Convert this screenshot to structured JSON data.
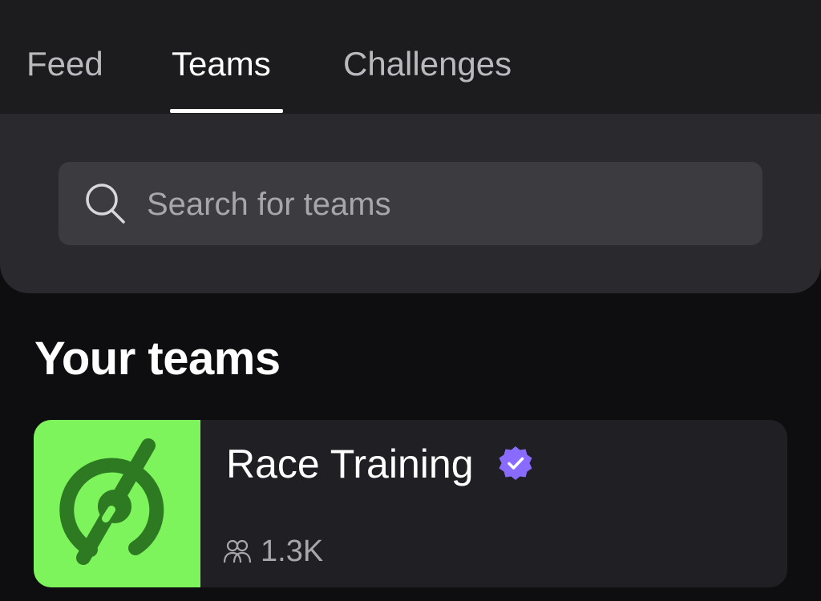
{
  "tabs": [
    {
      "label": "Feed",
      "active": false
    },
    {
      "label": "Teams",
      "active": true
    },
    {
      "label": "Challenges",
      "active": false
    }
  ],
  "search": {
    "placeholder": "Search for teams",
    "value": "",
    "icon": "search-icon"
  },
  "your_teams": {
    "title": "Your teams",
    "teams": [
      {
        "name": "Race Training",
        "verified": true,
        "member_count": "1.3K",
        "logo_icon": "peloton-logo",
        "logo_bg": "#7ef45c"
      }
    ]
  },
  "colors": {
    "background": "#0e0e10",
    "header": "#1c1c1f",
    "panel": "#2a2a2e",
    "search_box": "#3b3b40",
    "card": "#202024",
    "verified": "#8a6bff",
    "muted_text": "#a6a6ab"
  }
}
